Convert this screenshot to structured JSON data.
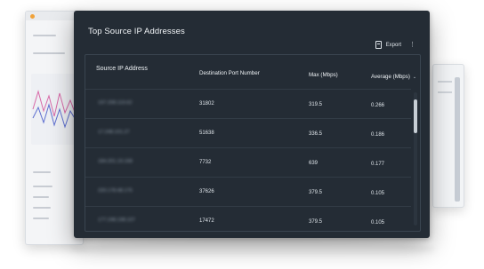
{
  "panel": {
    "title": "Top Source IP Addresses",
    "export_label": "Export",
    "menu_glyph": "⋮"
  },
  "table": {
    "columns": [
      "Source IP Address",
      "Destination Port Number",
      "Max (Mbps)",
      "Average (Mbps)"
    ],
    "sort_glyph": "⌄",
    "rows": [
      {
        "ip": "197.208.119.62",
        "port": "31802",
        "max": "319.5",
        "avg": "0.266"
      },
      {
        "ip": "17.248.101.27",
        "port": "51638",
        "max": "336.5",
        "avg": "0.186"
      },
      {
        "ip": "184.201.19.168",
        "port": "7732",
        "max": "639",
        "avg": "0.177"
      },
      {
        "ip": "220.178.48.175",
        "port": "37626",
        "max": "379.5",
        "avg": "0.105"
      },
      {
        "ip": "177.248.198.107",
        "port": "17472",
        "max": "379.5",
        "avg": "0.105"
      }
    ]
  },
  "colors": {
    "panel_bg": "#242c35",
    "text": "#e6ebf0",
    "accent_orange": "#f0a23a"
  },
  "icons": [
    "export-doc-icon",
    "kebab-menu-icon",
    "sort-chevron-icon"
  ]
}
